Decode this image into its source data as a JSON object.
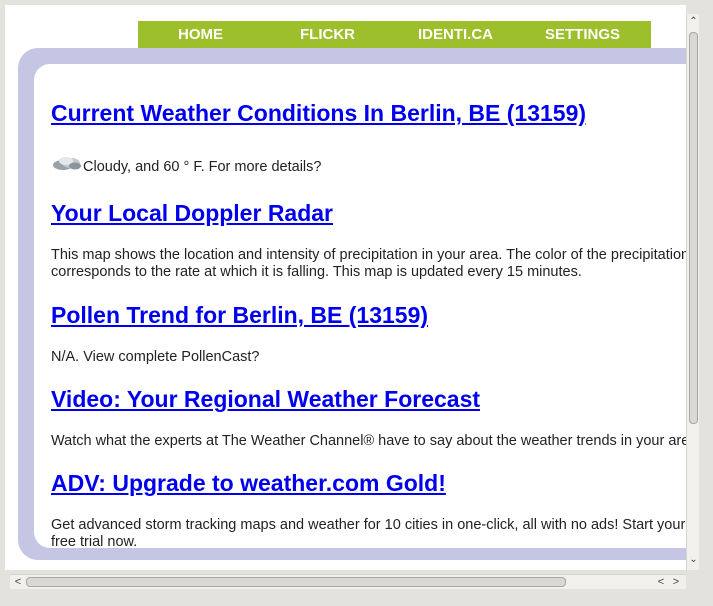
{
  "nav": {
    "home": "HOME",
    "flickr": "FLICKR",
    "identica": "IDENTI.CA",
    "settings": "SETTINGS"
  },
  "sections": [
    {
      "heading": "Current Weather Conditions In Berlin, BE (13159)",
      "icon": "cloud-icon",
      "text": "Cloudy, and 60 ° F. For more details?"
    },
    {
      "heading": "Your Local Doppler Radar",
      "text_line1": "This map shows the location and intensity of precipitation in your area. The color of the precipitation",
      "text_line2": "corresponds to the rate at which it is falling. This map is updated every 15 minutes."
    },
    {
      "heading": "Pollen Trend for Berlin, BE (13159)",
      "text": "N/A. View complete PollenCast?"
    },
    {
      "heading": "Video: Your Regional Weather Forecast",
      "text": "Watch what the experts at The Weather Channel® have to say about the weather trends in your area."
    },
    {
      "heading": "ADV: Upgrade to weather.com Gold!",
      "text_line1": "Get advanced storm tracking maps and weather for 10 cities in one-click, all with no ads! Start your",
      "text_line2": "free trial now."
    }
  ],
  "scrollbar": {
    "up": "⌃",
    "down": "⌄",
    "left": "<",
    "right": ">"
  },
  "colors": {
    "nav_bg": "#9cbf2b",
    "frame": "#c5c6e4",
    "link": "#0000ee"
  }
}
